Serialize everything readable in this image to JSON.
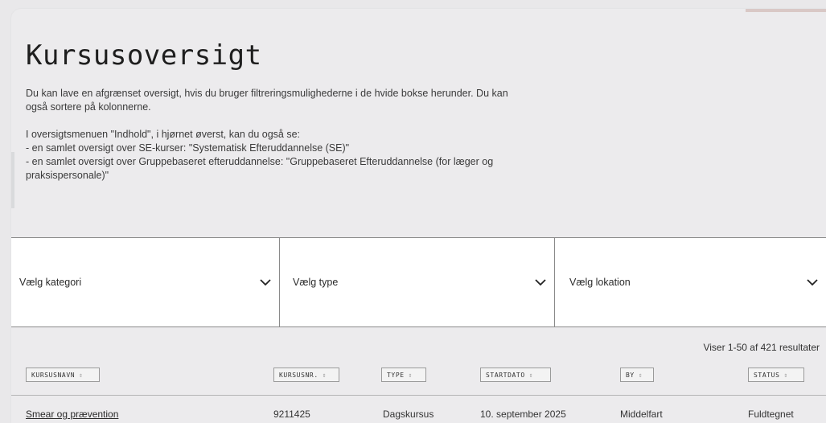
{
  "page": {
    "title": "Kursusoversigt",
    "intro": [
      "Du kan lave en afgrænset oversigt, hvis du bruger filtreringsmulighederne i de hvide bokse herunder. Du kan",
      "også sortere på kolonnerne."
    ],
    "menu_note": [
      "I oversigtsmenuen \"Indhold\", i hjørnet øverst, kan du også se:",
      "- en samlet oversigt over SE-kurser: \"Systematisk Efteruddannelse (SE)\"",
      "- en samlet oversigt over Gruppebaseret efteruddannelse: \"Gruppebaseret Efteruddannelse (for læger og",
      "praksispersonale)\""
    ]
  },
  "filters": {
    "category": "Vælg kategori",
    "type": "Vælg type",
    "location": "Vælg lokation"
  },
  "results_text": "Viser 1-50 af 421 resultater",
  "table": {
    "headers": [
      "KURSUSNAVN",
      "KURSUSNR.",
      "TYPE",
      "STARTDATO",
      "BY",
      "STATUS"
    ],
    "sort_glyph": "⇕",
    "rows": [
      {
        "name": "Smear og prævention",
        "number": "9211425",
        "type": "Dagskursus",
        "start": "10. september 2025",
        "city": "Middelfart",
        "status": "Fuldtegnet"
      }
    ]
  },
  "icons": {
    "filter_toggle": "chevron-down-icon",
    "sort": "sort-icon"
  },
  "colors": {
    "page_bg": "#ecebed",
    "filter_bg": "#ffffff",
    "border": "#8a8a8a"
  }
}
